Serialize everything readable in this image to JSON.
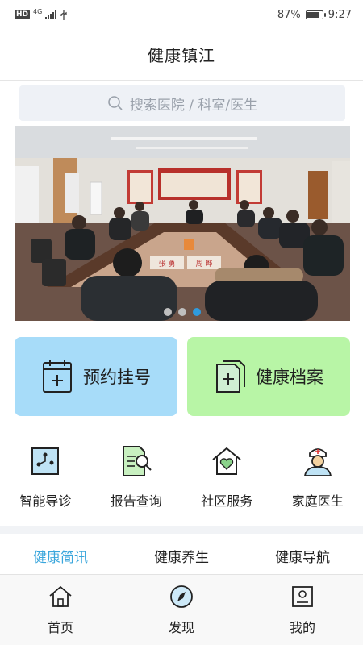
{
  "status_bar": {
    "hd": "HD",
    "network": "4G",
    "battery_percent": "87%",
    "battery_level": 0.87,
    "time": "9:27"
  },
  "header": {
    "title": "健康镇江"
  },
  "search": {
    "placeholder": "搜索医院 / 科室/医生"
  },
  "banner": {
    "nameplates": [
      "张 勇",
      "周 晔"
    ],
    "slide_count": 3,
    "active_slide": 3
  },
  "big_cards": [
    {
      "label": "预约挂号",
      "icon": "calendar-plus-icon",
      "color": "#a7dcf9"
    },
    {
      "label": "健康档案",
      "icon": "document-plus-icon",
      "color": "#b8f5a6"
    }
  ],
  "services": [
    {
      "label": "智能导诊",
      "icon": "smart-guide-icon"
    },
    {
      "label": "报告查询",
      "icon": "report-search-icon"
    },
    {
      "label": "社区服务",
      "icon": "community-home-icon"
    },
    {
      "label": "家庭医生",
      "icon": "doctor-icon"
    }
  ],
  "tabs": [
    {
      "label": "健康简讯",
      "active": true
    },
    {
      "label": "健康养生",
      "active": false
    },
    {
      "label": "健康导航",
      "active": false
    }
  ],
  "bottom_nav": [
    {
      "label": "首页",
      "icon": "home-icon"
    },
    {
      "label": "发现",
      "icon": "compass-icon"
    },
    {
      "label": "我的",
      "icon": "profile-icon"
    }
  ],
  "colors": {
    "accent": "#3aa6dc",
    "active_dot": "#2f9bde",
    "card_blue": "#a7dcf9",
    "card_green": "#b8f5a6"
  }
}
